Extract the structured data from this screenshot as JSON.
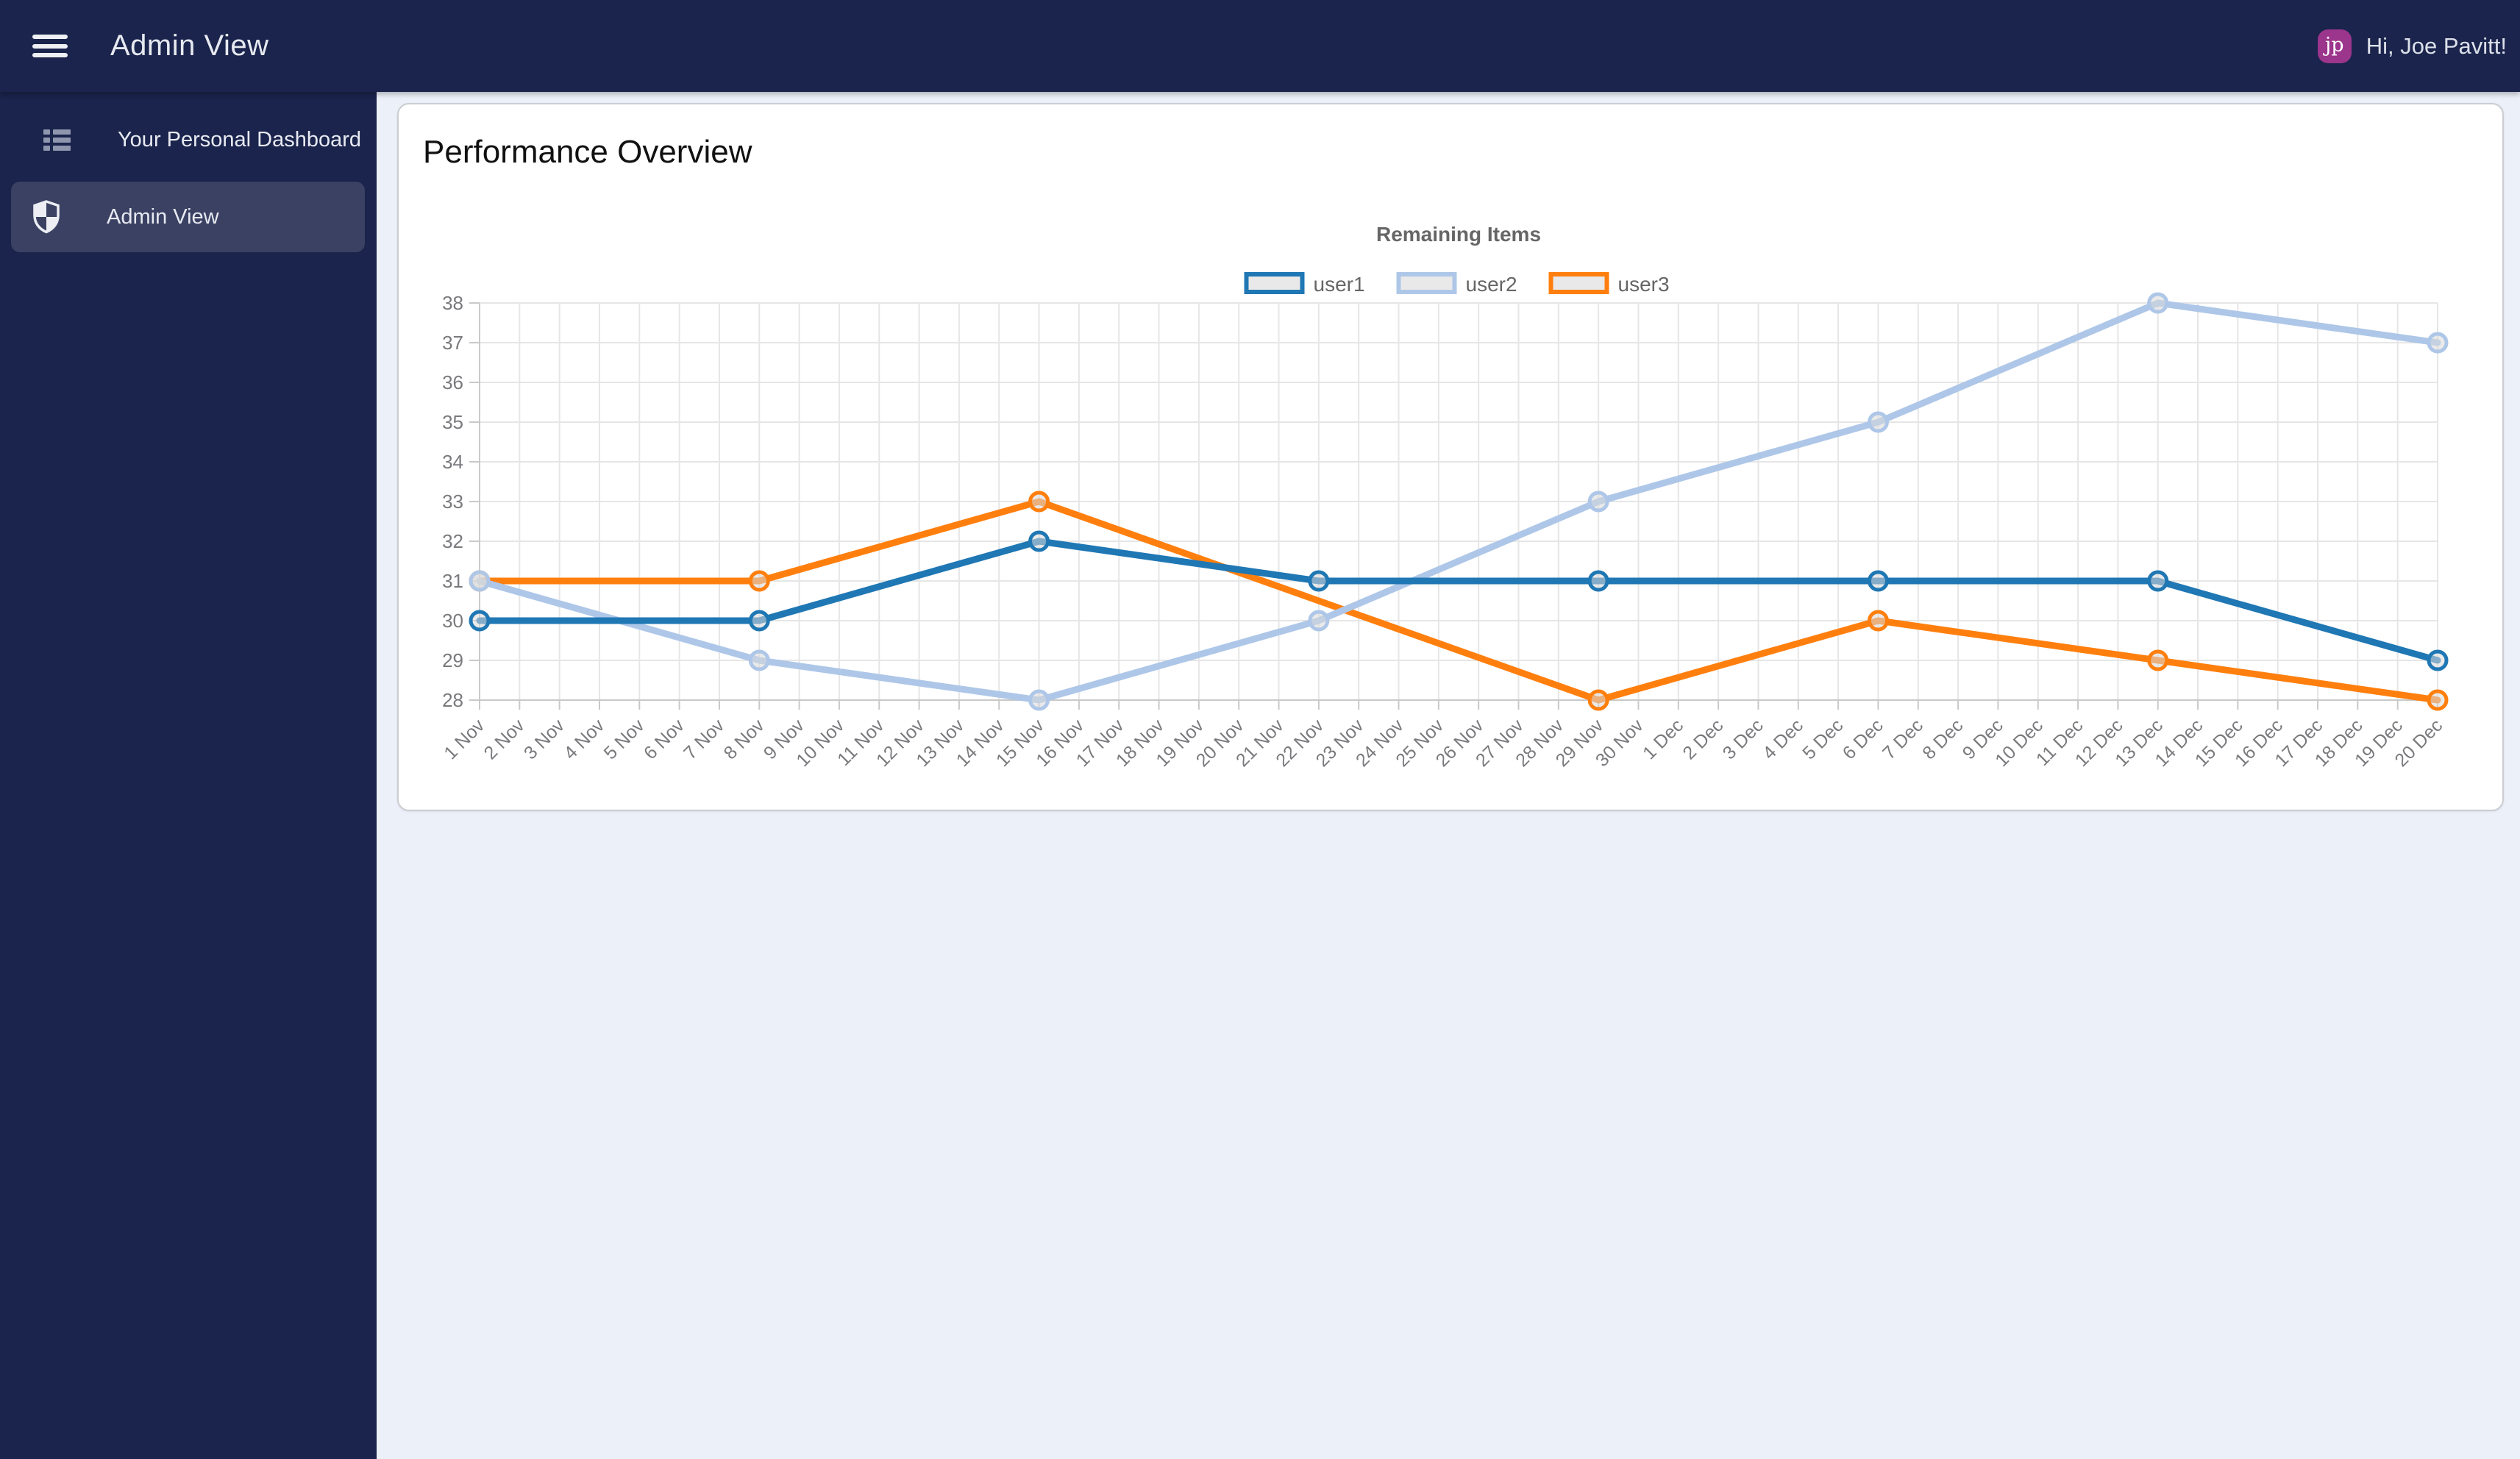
{
  "header": {
    "title": "Admin View",
    "greeting": "Hi, Joe Pavitt!",
    "avatar_initials": "jp",
    "icons": [
      "hamburger-menu-icon"
    ]
  },
  "sidebar": {
    "items": [
      {
        "label": "Your Personal Dashboard",
        "icon": "dashboard-list-icon",
        "active": false
      },
      {
        "label": "Admin View",
        "icon": "shield-icon",
        "active": true
      }
    ]
  },
  "card": {
    "title": "Performance Overview"
  },
  "colors": {
    "navy": "#1a244c",
    "active": "#3a4162",
    "content-bg": "#ecf0f8",
    "avatar-bg": "#9c358c",
    "icon-gray": "#8e97ad"
  },
  "chart_data": {
    "type": "line",
    "title": "Remaining Items",
    "title_color": "#666666",
    "axis_text_color": "#7a7a7e",
    "grid_color": "#e6e6e6",
    "axis_line_color": "#c9c9c9",
    "marker_fill": "#d9d9d9",
    "legend_position": "top",
    "grid": true,
    "ylim": [
      28,
      38
    ],
    "ytick_step": 1,
    "categories": [
      "1 Nov",
      "2 Nov",
      "3 Nov",
      "4 Nov",
      "5 Nov",
      "6 Nov",
      "7 Nov",
      "8 Nov",
      "9 Nov",
      "10 Nov",
      "11 Nov",
      "12 Nov",
      "13 Nov",
      "14 Nov",
      "15 Nov",
      "16 Nov",
      "17 Nov",
      "18 Nov",
      "19 Nov",
      "20 Nov",
      "21 Nov",
      "22 Nov",
      "23 Nov",
      "24 Nov",
      "25 Nov",
      "26 Nov",
      "27 Nov",
      "28 Nov",
      "29 Nov",
      "30 Nov",
      "1 Dec",
      "2 Dec",
      "3 Dec",
      "4 Dec",
      "5 Dec",
      "6 Dec",
      "7 Dec",
      "8 Dec",
      "9 Dec",
      "10 Dec",
      "11 Dec",
      "12 Dec",
      "13 Dec",
      "14 Dec",
      "15 Dec",
      "16 Dec",
      "17 Dec",
      "18 Dec",
      "19 Dec",
      "20 Dec"
    ],
    "series": [
      {
        "name": "user1",
        "color": "#1f77b4",
        "points": [
          [
            "1 Nov",
            30
          ],
          [
            "8 Nov",
            30
          ],
          [
            "15 Nov",
            32
          ],
          [
            "22 Nov",
            31
          ],
          [
            "29 Nov",
            31
          ],
          [
            "6 Dec",
            31
          ],
          [
            "13 Dec",
            31
          ],
          [
            "20 Dec",
            29
          ]
        ]
      },
      {
        "name": "user2",
        "color": "#aec7e8",
        "points": [
          [
            "1 Nov",
            31
          ],
          [
            "8 Nov",
            29
          ],
          [
            "15 Nov",
            28
          ],
          [
            "22 Nov",
            30
          ],
          [
            "29 Nov",
            33
          ],
          [
            "6 Dec",
            35
          ],
          [
            "13 Dec",
            38
          ],
          [
            "20 Dec",
            37
          ]
        ]
      },
      {
        "name": "user3",
        "color": "#ff7f0e",
        "points": [
          [
            "1 Nov",
            31
          ],
          [
            "8 Nov",
            31
          ],
          [
            "15 Nov",
            33
          ],
          [
            "29 Nov",
            28
          ],
          [
            "6 Dec",
            30
          ],
          [
            "13 Dec",
            29
          ],
          [
            "20 Dec",
            28
          ]
        ]
      }
    ]
  }
}
